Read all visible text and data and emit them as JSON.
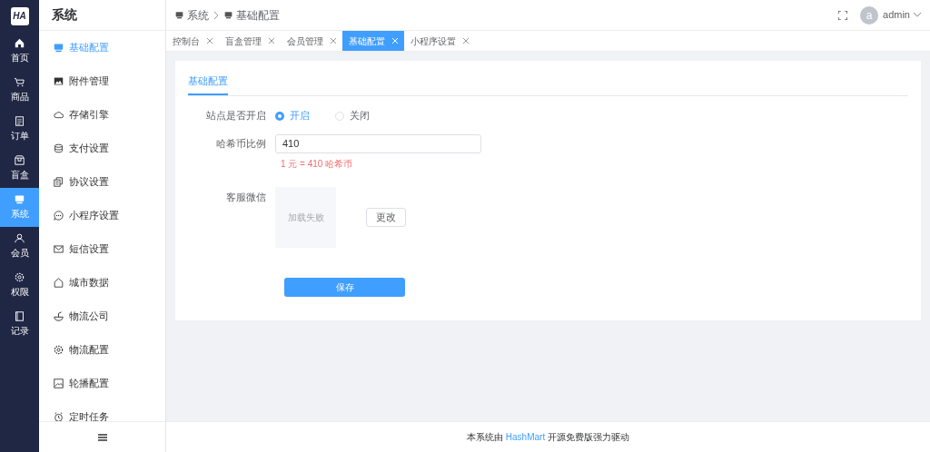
{
  "logo": "HA",
  "rail": [
    {
      "label": "首页",
      "selected": false
    },
    {
      "label": "商品",
      "selected": false
    },
    {
      "label": "订单",
      "selected": false
    },
    {
      "label": "盲盒",
      "selected": false
    },
    {
      "label": "系统",
      "selected": true
    },
    {
      "label": "会员",
      "selected": false
    },
    {
      "label": "权限",
      "selected": false
    },
    {
      "label": "记录",
      "selected": false
    }
  ],
  "submenu": {
    "title": "系统",
    "items": [
      {
        "label": "基础配置",
        "selected": true
      },
      {
        "label": "附件管理",
        "selected": false
      },
      {
        "label": "存储引擎",
        "selected": false
      },
      {
        "label": "支付设置",
        "selected": false
      },
      {
        "label": "协议设置",
        "selected": false
      },
      {
        "label": "小程序设置",
        "selected": false
      },
      {
        "label": "短信设置",
        "selected": false
      },
      {
        "label": "城市数据",
        "selected": false
      },
      {
        "label": "物流公司",
        "selected": false
      },
      {
        "label": "物流配置",
        "selected": false
      },
      {
        "label": "轮播配置",
        "selected": false
      },
      {
        "label": "定时任务",
        "selected": false
      }
    ]
  },
  "breadcrumb": [
    "系统",
    "基础配置"
  ],
  "user": {
    "avatar": "a",
    "name": "admin"
  },
  "tabs": [
    {
      "label": "控制台",
      "selected": false
    },
    {
      "label": "盲盒管理",
      "selected": false
    },
    {
      "label": "会员管理",
      "selected": false
    },
    {
      "label": "基础配置",
      "selected": true
    },
    {
      "label": "小程序设置",
      "selected": false
    }
  ],
  "card_tab": {
    "label": "基础配置",
    "selected": true
  },
  "form": {
    "site_open": {
      "label": "站点是否开启",
      "options": [
        {
          "label": "开启",
          "selected": true
        },
        {
          "label": "关闭",
          "selected": false
        }
      ]
    },
    "coin_ratio": {
      "label": "哈希币比例",
      "value": "410",
      "hint": "1 元 = 410 哈希币"
    },
    "service_wechat": {
      "label": "客服微信",
      "image_error": "加载失败",
      "change_button": "更改"
    },
    "save_button": "保存"
  },
  "footer": "本系统由 **HashMart** 开源免费版强力驱动"
}
